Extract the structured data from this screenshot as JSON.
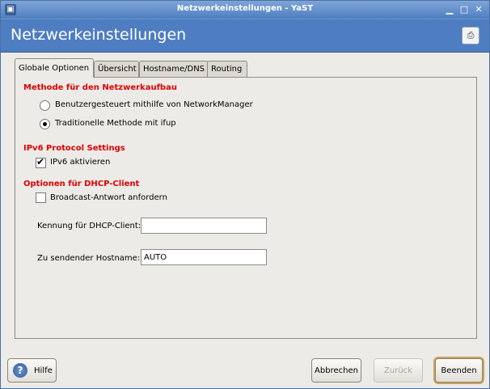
{
  "window": {
    "title": "Netzwerkeinstellungen - YaST"
  },
  "header": {
    "title": "Netzwerkeinstellungen",
    "help_icon": "help-browser-icon"
  },
  "tabs": [
    {
      "label": "Globale Optionen",
      "active": true
    },
    {
      "label": "Übersicht",
      "active": false
    },
    {
      "label": "Hostname/DNS",
      "active": false
    },
    {
      "label": "Routing",
      "active": false
    }
  ],
  "network_setup": {
    "heading": "Methode für den Netzwerkaufbau",
    "option_networkmanager": "Benutzergesteuert mithilfe von NetworkManager",
    "option_ifup": "Traditionelle Methode mit ifup",
    "selected": "ifup"
  },
  "ipv6": {
    "heading": "IPv6 Protocol Settings",
    "enable_label": "IPv6 aktivieren",
    "enabled": true
  },
  "dhcp": {
    "heading": "Optionen für DHCP-Client",
    "broadcast_label": "Broadcast-Antwort anfordern",
    "broadcast_checked": false,
    "client_id_label": "Kennung für DHCP-Client:",
    "client_id_value": "",
    "hostname_label": "Zu sendender Hostname:",
    "hostname_value": "AUTO"
  },
  "buttons": {
    "help": "Hilfe",
    "cancel": "Abbrechen",
    "back": "Zurück",
    "finish": "Beenden"
  }
}
